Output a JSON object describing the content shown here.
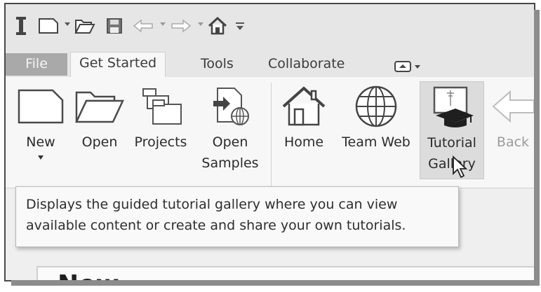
{
  "quick_access": {
    "icons": [
      "app-logo-icon",
      "new-file-icon",
      "open-folder-icon",
      "save-icon",
      "undo-icon",
      "redo-icon",
      "home-icon",
      "customize-icon"
    ]
  },
  "tabs": {
    "file": "File",
    "get_started": "Get Started",
    "tools": "Tools",
    "collaborate": "Collaborate"
  },
  "ribbon": {
    "new": "New",
    "open": "Open",
    "projects": "Projects",
    "open_samples_1": "Open",
    "open_samples_2": "Samples",
    "home": "Home",
    "team_web": "Team Web",
    "tutorial_gallery_1": "Tutorial",
    "tutorial_gallery_2": "Gallery",
    "back": "Back"
  },
  "tooltip": {
    "line1": "Displays the guided tutorial gallery where you can view",
    "line2": "available content or create and share your own tutorials."
  },
  "content": {
    "heading": "New"
  },
  "colors": {
    "toolbar_bg": "#e6e6e6",
    "ribbon_bg": "#f7f7f7",
    "file_tab": "#a9a9a9",
    "hover_btn": "#dcdcdc"
  }
}
